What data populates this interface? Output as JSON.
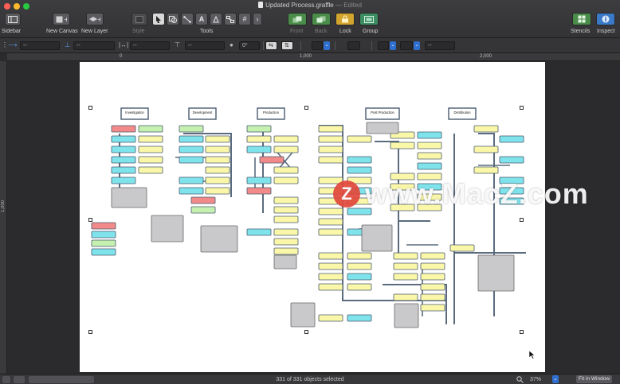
{
  "window": {
    "title": "Updated Process.graffle",
    "edited_suffix": "— Edited"
  },
  "toolbar": {
    "sidebar_label": "Sidebar",
    "new_canvas_label": "New Canvas",
    "new_layer_label": "New Layer",
    "style_label": "Style",
    "tools_label": "Tools",
    "front_label": "Front",
    "back_label": "Back",
    "lock_label": "Lock",
    "group_label": "Group",
    "stencils_label": "Stencils",
    "inspect_label": "Inspect",
    "tools": [
      "selection-arrow-icon",
      "shape-icon",
      "line-icon",
      "text-icon",
      "pen-icon",
      "diagram-icon",
      "table-icon"
    ],
    "text_tool_glyph": "A",
    "table_tool_glyph": "#",
    "more_tools_glyph": "›"
  },
  "inspector_bar": {
    "field_1": "--",
    "field_2": "--",
    "field_3": "--",
    "field_4": "--",
    "angle": "0°",
    "field_5": "--"
  },
  "rulers": {
    "h_ticks": [
      "0",
      "1,000",
      "2,000"
    ],
    "v_ticks": [
      "1,000"
    ]
  },
  "diagram": {
    "headers": [
      "Investigation",
      "Development",
      "Production",
      "Post Production",
      "Distribution"
    ]
  },
  "statusbar": {
    "selection_text": "331 of 331 objects selected",
    "zoom": "37%",
    "fit_label": "Fit in Window"
  },
  "watermark": {
    "logo_letter": "Z",
    "text": "www.MacZ.com"
  },
  "colors": {
    "box_blue": "#7fe3ec",
    "box_yellow": "#fbf7a9",
    "box_green": "#c5f0b0",
    "box_red": "#f28a8a",
    "note_grey": "#c9c9cc",
    "connector": "#5a6b7e"
  }
}
